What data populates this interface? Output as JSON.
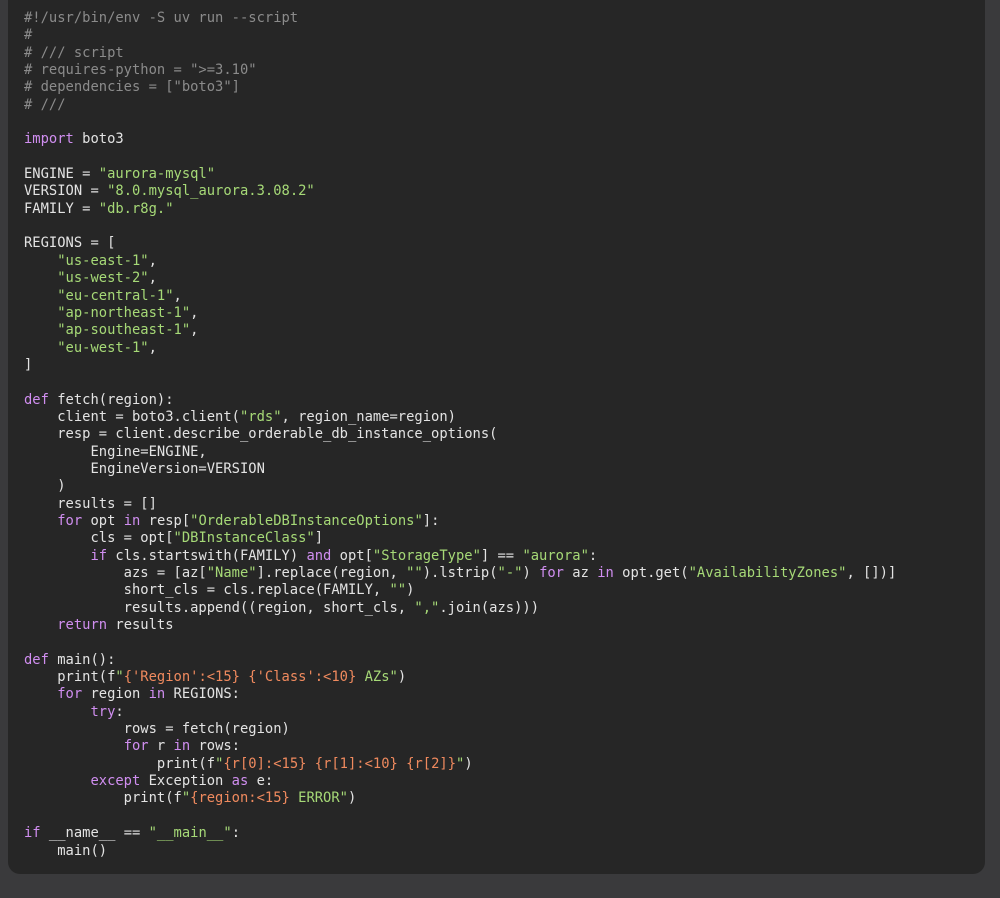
{
  "editor": {
    "lines": [
      [
        [
          "c",
          "#!/usr/bin/env -S uv run --script"
        ]
      ],
      [
        [
          "c",
          "#"
        ]
      ],
      [
        [
          "c",
          "# /// script"
        ]
      ],
      [
        [
          "c",
          "# requires-python = \">=3.10\""
        ]
      ],
      [
        [
          "c",
          "# dependencies = [\"boto3\"]"
        ]
      ],
      [
        [
          "c",
          "# ///"
        ]
      ],
      [],
      [
        [
          "k",
          "import"
        ],
        [
          "p",
          " boto3"
        ]
      ],
      [],
      [
        [
          "p",
          "ENGINE = "
        ],
        [
          "s",
          "\"aurora-mysql\""
        ]
      ],
      [
        [
          "p",
          "VERSION = "
        ],
        [
          "s",
          "\"8.0.mysql_aurora.3.08.2\""
        ]
      ],
      [
        [
          "p",
          "FAMILY = "
        ],
        [
          "s",
          "\"db.r8g.\""
        ]
      ],
      [],
      [
        [
          "p",
          "REGIONS = ["
        ]
      ],
      [
        [
          "p",
          "    "
        ],
        [
          "s",
          "\"us-east-1\""
        ],
        [
          "p",
          ","
        ]
      ],
      [
        [
          "p",
          "    "
        ],
        [
          "s",
          "\"us-west-2\""
        ],
        [
          "p",
          ","
        ]
      ],
      [
        [
          "p",
          "    "
        ],
        [
          "s",
          "\"eu-central-1\""
        ],
        [
          "p",
          ","
        ]
      ],
      [
        [
          "p",
          "    "
        ],
        [
          "s",
          "\"ap-northeast-1\""
        ],
        [
          "p",
          ","
        ]
      ],
      [
        [
          "p",
          "    "
        ],
        [
          "s",
          "\"ap-southeast-1\""
        ],
        [
          "p",
          ","
        ]
      ],
      [
        [
          "p",
          "    "
        ],
        [
          "s",
          "\"eu-west-1\""
        ],
        [
          "p",
          ","
        ]
      ],
      [
        [
          "p",
          "]"
        ]
      ],
      [],
      [
        [
          "k",
          "def"
        ],
        [
          "p",
          " fetch(region):"
        ]
      ],
      [
        [
          "p",
          "    client = boto3.client("
        ],
        [
          "s",
          "\"rds\""
        ],
        [
          "p",
          ", region_name=region)"
        ]
      ],
      [
        [
          "p",
          "    resp = client.describe_orderable_db_instance_options("
        ]
      ],
      [
        [
          "p",
          "        Engine=ENGINE,"
        ]
      ],
      [
        [
          "p",
          "        EngineVersion=VERSION"
        ]
      ],
      [
        [
          "p",
          "    )"
        ]
      ],
      [
        [
          "p",
          "    results = []"
        ]
      ],
      [
        [
          "p",
          "    "
        ],
        [
          "k",
          "for"
        ],
        [
          "p",
          " opt "
        ],
        [
          "k",
          "in"
        ],
        [
          "p",
          " resp["
        ],
        [
          "s",
          "\"OrderableDBInstanceOptions\""
        ],
        [
          "p",
          "]:"
        ]
      ],
      [
        [
          "p",
          "        cls = opt["
        ],
        [
          "s",
          "\"DBInstanceClass\""
        ],
        [
          "p",
          "]"
        ]
      ],
      [
        [
          "p",
          "        "
        ],
        [
          "k",
          "if"
        ],
        [
          "p",
          " cls.startswith(FAMILY) "
        ],
        [
          "k",
          "and"
        ],
        [
          "p",
          " opt["
        ],
        [
          "s",
          "\"StorageType\""
        ],
        [
          "p",
          "] == "
        ],
        [
          "s",
          "\"aurora\""
        ],
        [
          "p",
          ":"
        ]
      ],
      [
        [
          "p",
          "            azs = [az["
        ],
        [
          "s",
          "\"Name\""
        ],
        [
          "p",
          "].replace(region, "
        ],
        [
          "s",
          "\"\""
        ],
        [
          "p",
          ").lstrip("
        ],
        [
          "s",
          "\"-\""
        ],
        [
          "p",
          ") "
        ],
        [
          "k",
          "for"
        ],
        [
          "p",
          " az "
        ],
        [
          "k",
          "in"
        ],
        [
          "p",
          " opt.get("
        ],
        [
          "s",
          "\"AvailabilityZones\""
        ],
        [
          "p",
          ", [])]"
        ]
      ],
      [
        [
          "p",
          "            short_cls = cls.replace(FAMILY, "
        ],
        [
          "s",
          "\"\""
        ],
        [
          "p",
          ")"
        ]
      ],
      [
        [
          "p",
          "            results.append((region, short_cls, "
        ],
        [
          "s",
          "\",\""
        ],
        [
          "p",
          ".join(azs)))"
        ]
      ],
      [
        [
          "p",
          "    "
        ],
        [
          "k",
          "return"
        ],
        [
          "p",
          " results"
        ]
      ],
      [],
      [
        [
          "k",
          "def"
        ],
        [
          "p",
          " main():"
        ]
      ],
      [
        [
          "p",
          "    print(f"
        ],
        [
          "s",
          "\""
        ],
        [
          "i",
          "{'Region':<15}"
        ],
        [
          "s",
          " "
        ],
        [
          "i",
          "{'Class':<10}"
        ],
        [
          "s",
          " AZs\""
        ],
        [
          "p",
          ")"
        ]
      ],
      [
        [
          "p",
          "    "
        ],
        [
          "k",
          "for"
        ],
        [
          "p",
          " region "
        ],
        [
          "k",
          "in"
        ],
        [
          "p",
          " REGIONS:"
        ]
      ],
      [
        [
          "p",
          "        "
        ],
        [
          "k",
          "try"
        ],
        [
          "p",
          ":"
        ]
      ],
      [
        [
          "p",
          "            rows = fetch(region)"
        ]
      ],
      [
        [
          "p",
          "            "
        ],
        [
          "k",
          "for"
        ],
        [
          "p",
          " r "
        ],
        [
          "k",
          "in"
        ],
        [
          "p",
          " rows:"
        ]
      ],
      [
        [
          "p",
          "                print(f"
        ],
        [
          "s",
          "\""
        ],
        [
          "i",
          "{r[0]:<15}"
        ],
        [
          "s",
          " "
        ],
        [
          "i",
          "{r[1]:<10}"
        ],
        [
          "s",
          " "
        ],
        [
          "i",
          "{r[2]}"
        ],
        [
          "s",
          "\""
        ],
        [
          "p",
          ")"
        ]
      ],
      [
        [
          "p",
          "        "
        ],
        [
          "k",
          "except"
        ],
        [
          "p",
          " Exception "
        ],
        [
          "k",
          "as"
        ],
        [
          "p",
          " e:"
        ]
      ],
      [
        [
          "p",
          "            print(f"
        ],
        [
          "s",
          "\""
        ],
        [
          "i",
          "{region:<15}"
        ],
        [
          "s",
          " ERROR\""
        ],
        [
          "p",
          ")"
        ]
      ],
      [],
      [
        [
          "k",
          "if"
        ],
        [
          "p",
          " __name__ == "
        ],
        [
          "s",
          "\"__main__\""
        ],
        [
          "p",
          ":"
        ]
      ],
      [
        [
          "p",
          "    main()"
        ]
      ]
    ],
    "colors": {
      "background": "#262626",
      "outer": "#3a3a3c",
      "comment": "#8b8b8b",
      "keyword": "#d08ef0",
      "string": "#a6d977",
      "interpolation": "#f08a5e",
      "plain": "#e3e3e3"
    }
  }
}
